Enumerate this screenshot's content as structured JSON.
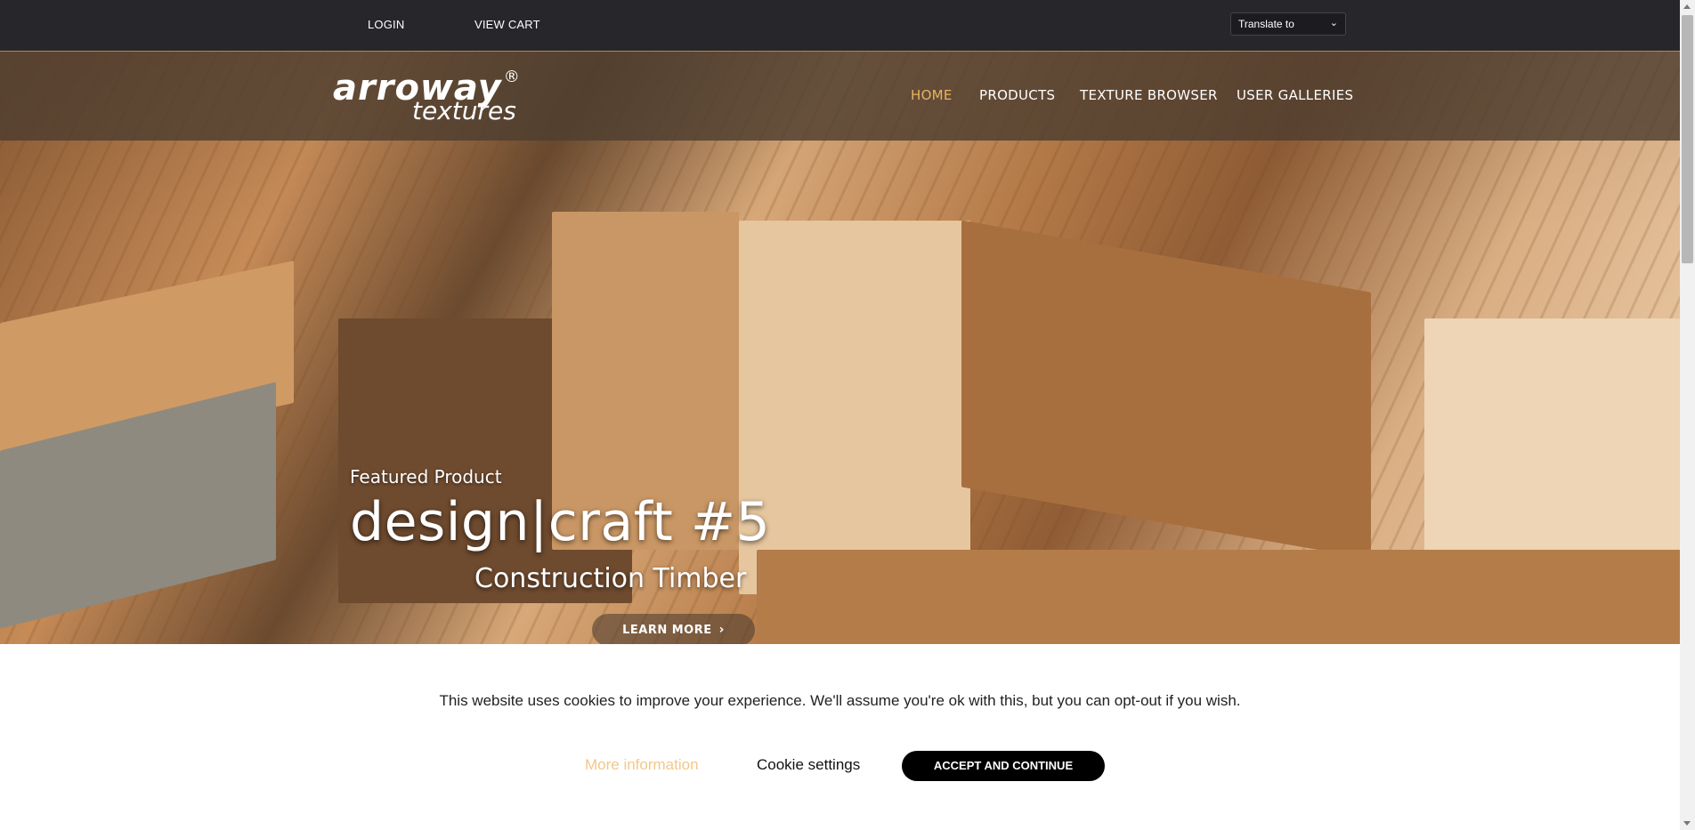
{
  "topbar": {
    "login": "LOGIN",
    "view_cart": "VIEW CART",
    "translate_label": "Translate to"
  },
  "header": {
    "logo_main": "arroway",
    "logo_reg": "®",
    "logo_sub": "textures",
    "nav": [
      "HOME",
      "PRODUCTS",
      "TEXTURE BROWSER",
      "USER GALLERIES"
    ]
  },
  "hero": {
    "featured_label": "Featured Product",
    "title": "design|craft #5",
    "subtitle": "Construction Timber",
    "cta": "LEARN MORE"
  },
  "cookie": {
    "message": "This website uses cookies to improve your experience. We'll assume you're ok with this, but you can opt-out if you wish.",
    "more_info": "More information",
    "settings": "Cookie settings",
    "accept": "ACCEPT AND CONTINUE"
  },
  "colors": {
    "topbar_bg": "#27262b",
    "nav_active": "#e9b35e",
    "more_info": "#f2c88a",
    "accept_bg": "#000000"
  },
  "icons": [
    "chevron-down-icon",
    "chevron-right-icon"
  ]
}
